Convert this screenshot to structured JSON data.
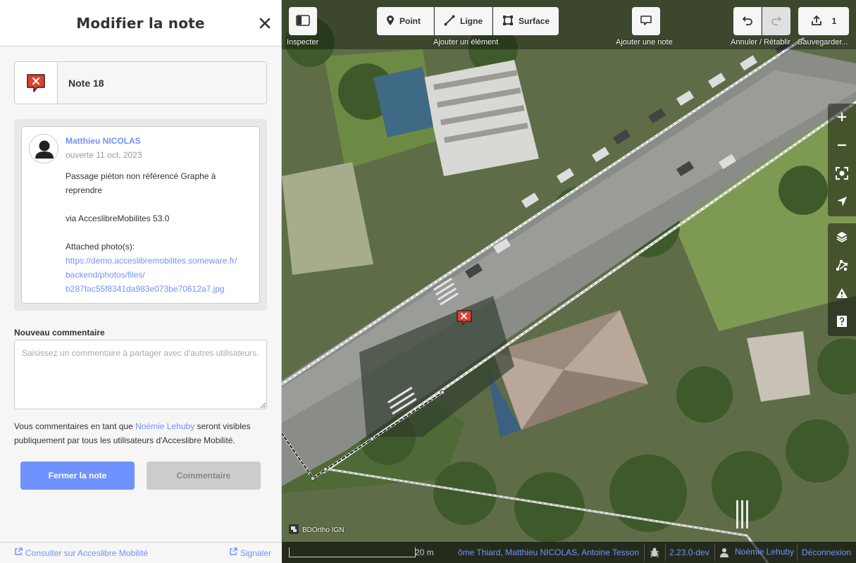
{
  "sidebar": {
    "title": "Modifier la note",
    "note_label": "Note 18",
    "comment": {
      "author": "Matthieu NICOLAS",
      "date": "ouverte 11 oct. 2023",
      "text_line1": "Passage piéton non référencé Graphe à reprendre",
      "text_line2": "via AcceslibreMobilites 53.0",
      "text_line3": "Attached photo(s):",
      "link_line1": "https://demo.acceslibremobilites.someware.fr/",
      "link_line2": "backend/photos/files/",
      "link_line3": "b287fac55f8341da983e073be70612a7.jpg"
    },
    "new_comment_label": "Nouveau commentaire",
    "new_comment_placeholder": "Saisissez un commentaire à partager avec d'autres utilisateurs.",
    "visibility_prefix": "Vous commentaires en tant que ",
    "visibility_user": "Noémie Lehuby",
    "visibility_suffix": " seront visibles publiquement par tous les utilisateurs d'Acceslibre Mobilité.",
    "close_note_label": "Fermer la note",
    "comment_button_label": "Commentaire",
    "footer_view_link": "Consulter sur Acceslibre Mobilité",
    "footer_report_link": "Signaler"
  },
  "toolbar": {
    "inspect_label": "Inspecter",
    "point_label": "Point",
    "line_label": "Ligne",
    "area_label": "Surface",
    "add_feature_label": "Ajouter un élément",
    "add_note_label": "Ajouter une note",
    "undo_redo_label": "Annuler / Rétablir",
    "save_count": "1",
    "save_label": "Sauvegarder..."
  },
  "map": {
    "attribution": "BDOrtho IGN",
    "scale_label": "20 m",
    "contributors": "ôme Thiard, Matthieu NICOLAS, Antoine Tesson",
    "version": "2.23.0-dev",
    "user": "Noémie Lehuby",
    "logout": "Déconnexion"
  },
  "colors": {
    "accent": "#7092ff",
    "note_red": "#e0412d"
  }
}
